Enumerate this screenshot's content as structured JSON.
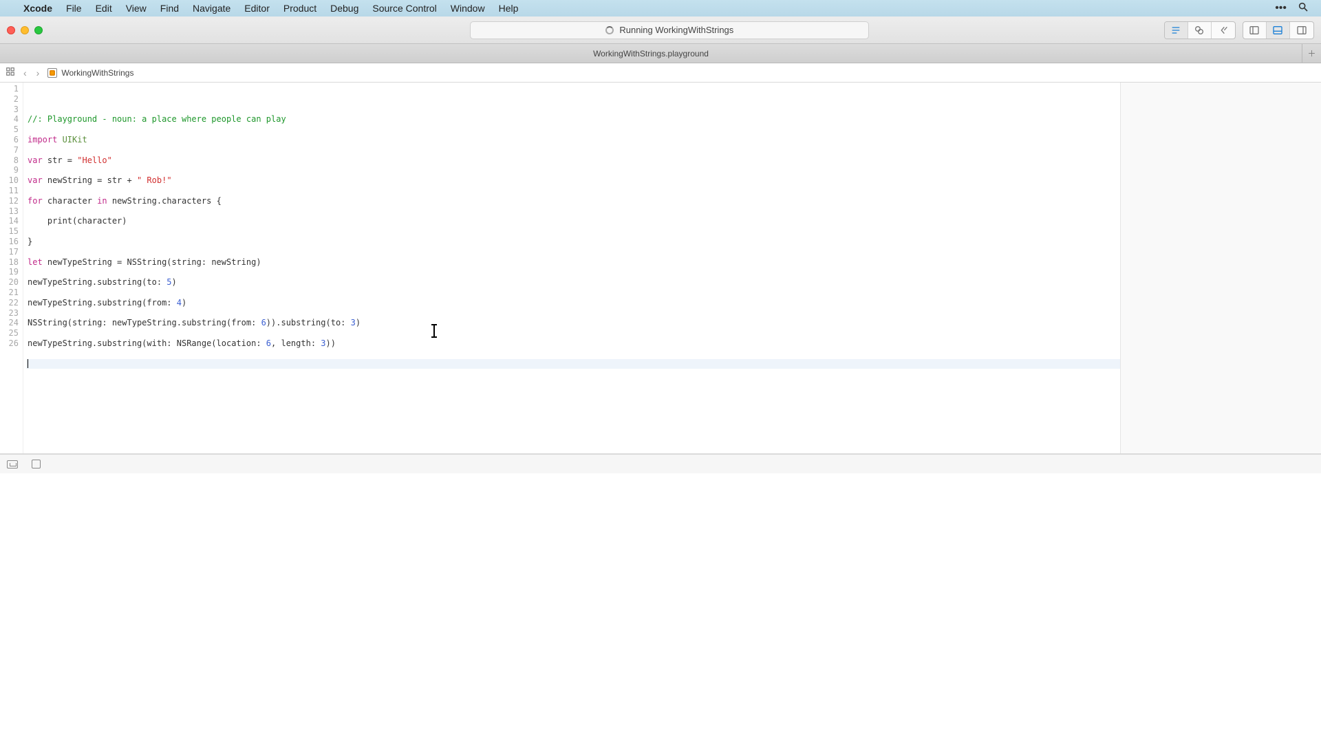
{
  "menubar": {
    "app": "Xcode",
    "items": [
      "File",
      "Edit",
      "View",
      "Find",
      "Navigate",
      "Editor",
      "Product",
      "Debug",
      "Source Control",
      "Window",
      "Help"
    ]
  },
  "toolbar": {
    "status": "Running WorkingWithStrings"
  },
  "tabbar": {
    "tab": "WorkingWithStrings.playground"
  },
  "jumpbar": {
    "file": "WorkingWithStrings"
  },
  "code": {
    "lines": [
      {
        "n": 1,
        "t": "comment",
        "text": "//: Playground - noun: a place where people can play"
      },
      {
        "n": 2,
        "t": "blank",
        "text": ""
      },
      {
        "n": 3,
        "t": "import",
        "kw": "import",
        "rest": " UIKit"
      },
      {
        "n": 4,
        "t": "blank",
        "text": ""
      },
      {
        "n": 5,
        "t": "vardecl",
        "kw": "var",
        "name": " str = ",
        "str": "\"Hello\""
      },
      {
        "n": 6,
        "t": "blank",
        "text": ""
      },
      {
        "n": 7,
        "t": "vardecl2",
        "kw": "var",
        "name": " newString = str + ",
        "str": "\" Rob!\""
      },
      {
        "n": 8,
        "t": "blank",
        "text": ""
      },
      {
        "n": 9,
        "t": "for",
        "kw1": "for",
        "mid": " character ",
        "kw2": "in",
        "rest": " newString.characters {"
      },
      {
        "n": 10,
        "t": "blank",
        "text": ""
      },
      {
        "n": 11,
        "t": "plain",
        "text": "    print(character)"
      },
      {
        "n": 12,
        "t": "blank",
        "text": ""
      },
      {
        "n": 13,
        "t": "plain",
        "text": "}"
      },
      {
        "n": 14,
        "t": "blank",
        "text": ""
      },
      {
        "n": 15,
        "t": "let",
        "kw": "let",
        "name": " newTypeString = NSString(string: newString)"
      },
      {
        "n": 16,
        "t": "blank",
        "text": ""
      },
      {
        "n": 17,
        "t": "call",
        "pre": "newTypeString.substring(to: ",
        "num": "5",
        "post": ")"
      },
      {
        "n": 18,
        "t": "blank",
        "text": ""
      },
      {
        "n": 19,
        "t": "call",
        "pre": "newTypeString.substring(from: ",
        "num": "4",
        "post": ")"
      },
      {
        "n": 20,
        "t": "blank",
        "text": ""
      },
      {
        "n": 21,
        "t": "call2",
        "pre": "NSString(string: newTypeString.substring(from: ",
        "num1": "6",
        "mid": ")).substring(to: ",
        "num2": "3",
        "post": ")"
      },
      {
        "n": 22,
        "t": "blank",
        "text": ""
      },
      {
        "n": 23,
        "t": "call2",
        "pre": "newTypeString.substring(with: NSRange(location: ",
        "num1": "6",
        "mid": ", length: ",
        "num2": "3",
        "post": "))"
      },
      {
        "n": 24,
        "t": "blank",
        "text": ""
      },
      {
        "n": 25,
        "t": "cursor",
        "text": ""
      },
      {
        "n": 26,
        "t": "blank",
        "text": ""
      }
    ]
  }
}
